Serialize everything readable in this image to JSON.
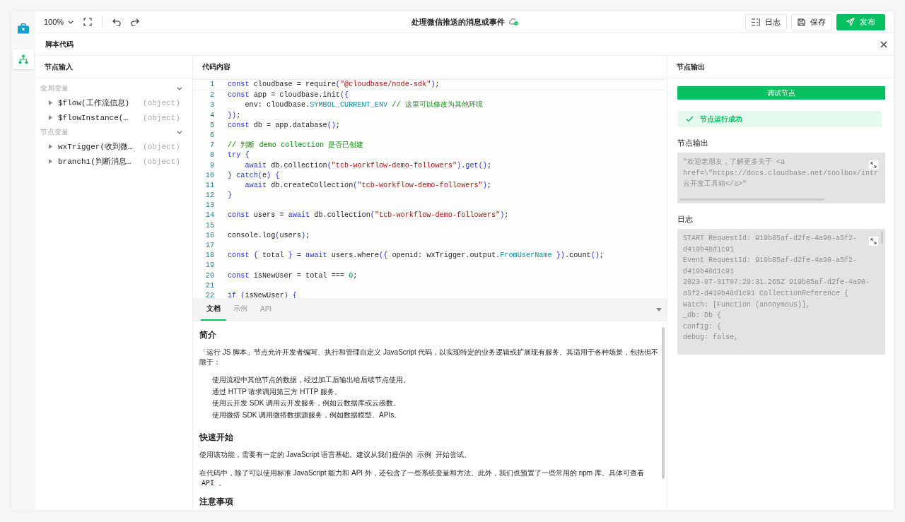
{
  "rail": [
    {
      "kind": "toolbox",
      "selected": false
    },
    {
      "kind": "flow",
      "selected": true
    }
  ],
  "toolbar": {
    "zoom": "100%",
    "title": "处理微信推送的消息或事件",
    "buttons": [
      {
        "kind": "log",
        "label": "日志"
      },
      {
        "kind": "save",
        "label": "保存"
      },
      {
        "kind": "publish",
        "label": "发布"
      }
    ]
  },
  "panel_title": "脚本代码",
  "inputs": {
    "title": "节点输入",
    "groups": [
      {
        "label": "全局变量",
        "expanded": true,
        "items": [
          {
            "name": "$flow(工作流信息)",
            "type": "(object)"
          },
          {
            "name": "$flowInstance(…",
            "type": "(object)"
          }
        ]
      },
      {
        "label": "节点变量",
        "expanded": true,
        "items": [
          {
            "name": "wxTrigger(收到微…",
            "type": "(object)"
          },
          {
            "name": "branch1(判断消息…",
            "type": "(object)"
          }
        ]
      }
    ]
  },
  "code": {
    "title": "代码内容",
    "lines": [
      {
        "n": "1",
        "tokens": [
          {
            "t": "const",
            "kind": "kw"
          },
          {
            "t": " cloudbase = require",
            "kind": "p"
          },
          {
            "t": "(",
            "kind": "br"
          },
          {
            "t": "\"@cloudbase/node-sdk\"",
            "kind": "str"
          },
          {
            "t": ")",
            "kind": "br"
          },
          {
            "t": ";",
            "kind": "p"
          }
        ]
      },
      {
        "n": "2",
        "tokens": [
          {
            "t": "const",
            "kind": "kw"
          },
          {
            "t": " app = cloudbase.init",
            "kind": "p"
          },
          {
            "t": "({",
            "kind": "br"
          }
        ]
      },
      {
        "n": "3",
        "tokens": [
          {
            "t": "    env: cloudbase.",
            "kind": "p"
          },
          {
            "t": "SYMBOL_CURRENT_ENV",
            "kind": "prop"
          },
          {
            "t": " // 这里可以修改为其他环境",
            "kind": "com"
          }
        ]
      },
      {
        "n": "4",
        "tokens": [
          {
            "t": "})",
            "kind": "br"
          },
          {
            "t": ";",
            "kind": "p"
          }
        ]
      },
      {
        "n": "5",
        "tokens": [
          {
            "t": "const",
            "kind": "kw"
          },
          {
            "t": " db = app.database",
            "kind": "p"
          },
          {
            "t": "()",
            "kind": "br"
          },
          {
            "t": ";",
            "kind": "p"
          }
        ]
      },
      {
        "n": "6"
      },
      {
        "n": "7",
        "tokens": [
          {
            "t": "// 判断 demo collection 是否已创建",
            "kind": "com"
          }
        ]
      },
      {
        "n": "8",
        "tokens": [
          {
            "t": "try",
            "kind": "kw"
          },
          {
            "t": " {",
            "kind": "br"
          }
        ]
      },
      {
        "n": "9",
        "tokens": [
          {
            "t": "    await",
            "kind": "kw"
          },
          {
            "t": " db.collection",
            "kind": "p"
          },
          {
            "t": "(",
            "kind": "br"
          },
          {
            "t": "\"tcb-workflow-demo-followers\"",
            "kind": "str"
          },
          {
            "t": ")",
            "kind": "br"
          },
          {
            "t": ".",
            "kind": "p"
          },
          {
            "t": "get",
            "kind": "kw"
          },
          {
            "t": "()",
            "kind": "br"
          },
          {
            "t": ";",
            "kind": "p"
          }
        ]
      },
      {
        "n": "10",
        "tokens": [
          {
            "t": "}",
            "kind": "br"
          },
          {
            "t": " catch",
            "kind": "kw"
          },
          {
            "t": "(",
            "kind": "br"
          },
          {
            "t": "e",
            "kind": "p"
          },
          {
            "t": ")",
            "kind": "br"
          },
          {
            "t": " {",
            "kind": "br"
          }
        ]
      },
      {
        "n": "11",
        "tokens": [
          {
            "t": "    await",
            "kind": "kw"
          },
          {
            "t": " db.createCollection",
            "kind": "p"
          },
          {
            "t": "(",
            "kind": "br"
          },
          {
            "t": "\"tcb-workflow-demo-followers\"",
            "kind": "str"
          },
          {
            "t": ")",
            "kind": "br"
          },
          {
            "t": ";",
            "kind": "p"
          }
        ]
      },
      {
        "n": "12",
        "tokens": [
          {
            "t": "}",
            "kind": "br"
          }
        ]
      },
      {
        "n": "13"
      },
      {
        "n": "14",
        "tokens": [
          {
            "t": "const",
            "kind": "kw"
          },
          {
            "t": " users = ",
            "kind": "p"
          },
          {
            "t": "await",
            "kind": "kw"
          },
          {
            "t": " db.collection",
            "kind": "p"
          },
          {
            "t": "(",
            "kind": "br"
          },
          {
            "t": "\"tcb-workflow-demo-followers\"",
            "kind": "str"
          },
          {
            "t": ")",
            "kind": "br"
          },
          {
            "t": ";",
            "kind": "p"
          }
        ]
      },
      {
        "n": "15"
      },
      {
        "n": "16",
        "tokens": [
          {
            "t": "console.log",
            "kind": "p"
          },
          {
            "t": "(",
            "kind": "br"
          },
          {
            "t": "users",
            "kind": "p"
          },
          {
            "t": ")",
            "kind": "br"
          },
          {
            "t": ";",
            "kind": "p"
          }
        ]
      },
      {
        "n": "17"
      },
      {
        "n": "18",
        "tokens": [
          {
            "t": "const",
            "kind": "kw"
          },
          {
            "t": " {",
            "kind": "br"
          },
          {
            "t": " total ",
            "kind": "p"
          },
          {
            "t": "}",
            "kind": "br"
          },
          {
            "t": " = ",
            "kind": "p"
          },
          {
            "t": "await",
            "kind": "kw"
          },
          {
            "t": " users.where",
            "kind": "p"
          },
          {
            "t": "({",
            "kind": "br"
          },
          {
            "t": " openid: wxTrigger.output.",
            "kind": "p"
          },
          {
            "t": "FromUserName",
            "kind": "prop"
          },
          {
            "t": " })",
            "kind": "br"
          },
          {
            "t": ".count",
            "kind": "p"
          },
          {
            "t": "()",
            "kind": "br"
          },
          {
            "t": ";",
            "kind": "p"
          }
        ]
      },
      {
        "n": "19"
      },
      {
        "n": "20",
        "tokens": [
          {
            "t": "const",
            "kind": "kw"
          },
          {
            "t": " isNewUser = total === ",
            "kind": "p"
          },
          {
            "t": "0",
            "kind": "num"
          },
          {
            "t": ";",
            "kind": "p"
          }
        ]
      },
      {
        "n": "21"
      },
      {
        "n": "22",
        "tokens": [
          {
            "t": "if",
            "kind": "kw"
          },
          {
            "t": " (",
            "kind": "br"
          },
          {
            "t": "isNewUser",
            "kind": "p"
          },
          {
            "t": ")",
            "kind": "br"
          },
          {
            "t": " {",
            "kind": "br"
          }
        ]
      }
    ]
  },
  "docs": {
    "tabs": [
      {
        "label": "文档",
        "selected": true
      },
      {
        "label": "示例",
        "selected": false
      },
      {
        "label": "API",
        "selected": false
      }
    ],
    "sections": [
      {
        "title": "简介",
        "blocks": [
          {
            "kind": "para",
            "parts": [
              {
                "kind": "text",
                "text": "「运行 JS 脚本」节点允许开发者编写、执行和管理自定义 JavaScript 代码，以实现特定的业务逻辑或扩展现有服务。其适用于各种场景，包括但不限于："
              }
            ]
          },
          {
            "kind": "list",
            "items": [
              "使用流程中其他节点的数据，经过加工后输出给后续节点使用。",
              "通过 HTTP 请求调用第三方 HTTP 服务。",
              "使用云开发 SDK 调用云开发服务，例如云数据库或云函数。",
              "使用微搭 SDK 调用微搭数据源服务，例如数据模型、APIs。"
            ]
          }
        ]
      },
      {
        "title": "快速开始",
        "blocks": [
          {
            "kind": "para",
            "parts": [
              {
                "kind": "text",
                "text": "使用该功能，需要有一定的 JavaScript 语言基础。建议从我们提供的 "
              },
              {
                "kind": "code",
                "text": "示例"
              },
              {
                "kind": "text",
                "text": " 开始尝试。"
              }
            ]
          },
          {
            "kind": "para",
            "parts": [
              {
                "kind": "text",
                "text": "在代码中，除了可以使用标准 JavaScript 能力和 API 外，还包含了一些系统变量和方法。此外，我们也预置了一些常用的 npm 库。具体可查看 "
              },
              {
                "kind": "code",
                "text": "API"
              },
              {
                "kind": "text",
                "text": " 。"
              }
            ]
          }
        ]
      },
      {
        "title": "注意事项"
      }
    ]
  },
  "outputs": {
    "title": "节点输出",
    "debug_button": "调试节点",
    "status": {
      "ok": true,
      "text": "节点运行成功"
    },
    "output_label": "节点输出",
    "output_lines": [
      "\"欢迎老朋友，了解更多关于 <a",
      "href=\\\"https://docs.cloudbase.net/toolbox/intr",
      "云开发工具箱</a>\""
    ],
    "log_label": "日志",
    "log_lines": [
      "START RequestId: 919b85af-d2fe-4a90-a5f2-",
      "d419b48d1c91",
      "Event RequestId: 919b85af-d2fe-4a90-a5f2-",
      "d419b48d1c91",
      "2023-07-31T07:29:31.265Z 919b85af-d2fe-4a90-",
      "a5f2-d419b48d1c91 CollectionReference {",
      "watch: [Function (anonymous)],",
      "_db: Db {",
      "config: {",
      "debug: false,"
    ]
  }
}
